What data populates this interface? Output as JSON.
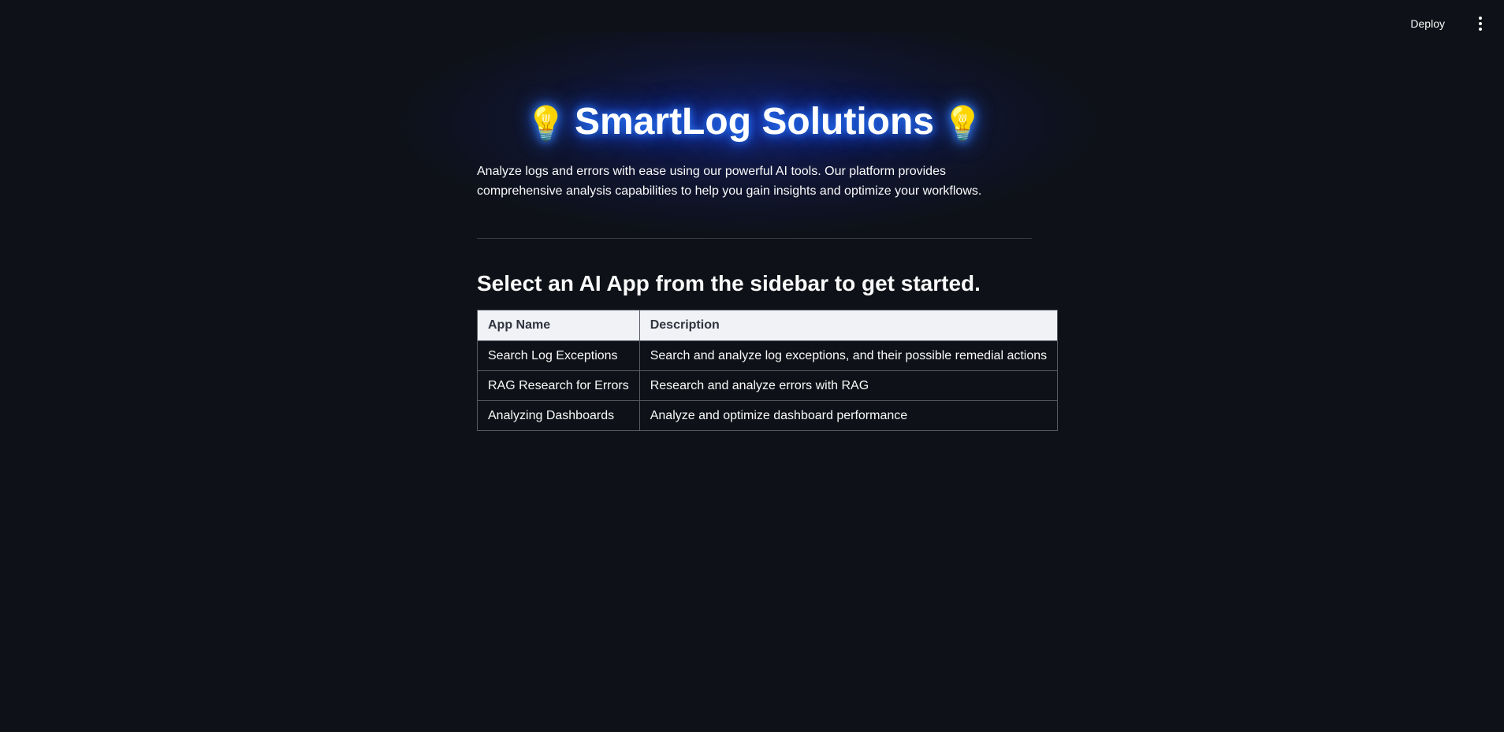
{
  "header": {
    "deploy_label": "Deploy",
    "menu_icon": "kebab-menu-icon"
  },
  "hero": {
    "title": "SmartLog Solutions",
    "left_icon": "💡",
    "right_icon": "💡",
    "intro": "Analyze logs and errors with ease using our powerful AI tools. Our platform provides comprehensive analysis capabilities to help you gain insights and optimize your workflows."
  },
  "main": {
    "subheading": "Select an AI App from the sidebar to get started.",
    "table": {
      "headers": [
        "App Name",
        "Description"
      ],
      "rows": [
        [
          "Search Log Exceptions",
          "Search and analyze log exceptions, and their possible remedial actions"
        ],
        [
          "RAG Research for Errors",
          "Research and analyze errors with RAG"
        ],
        [
          "Analyzing Dashboards",
          "Analyze and optimize dashboard performance"
        ]
      ]
    }
  },
  "colors": {
    "background": "#0e1117",
    "glow": "#1f5fff",
    "table_header_bg": "#f0f2f6"
  }
}
